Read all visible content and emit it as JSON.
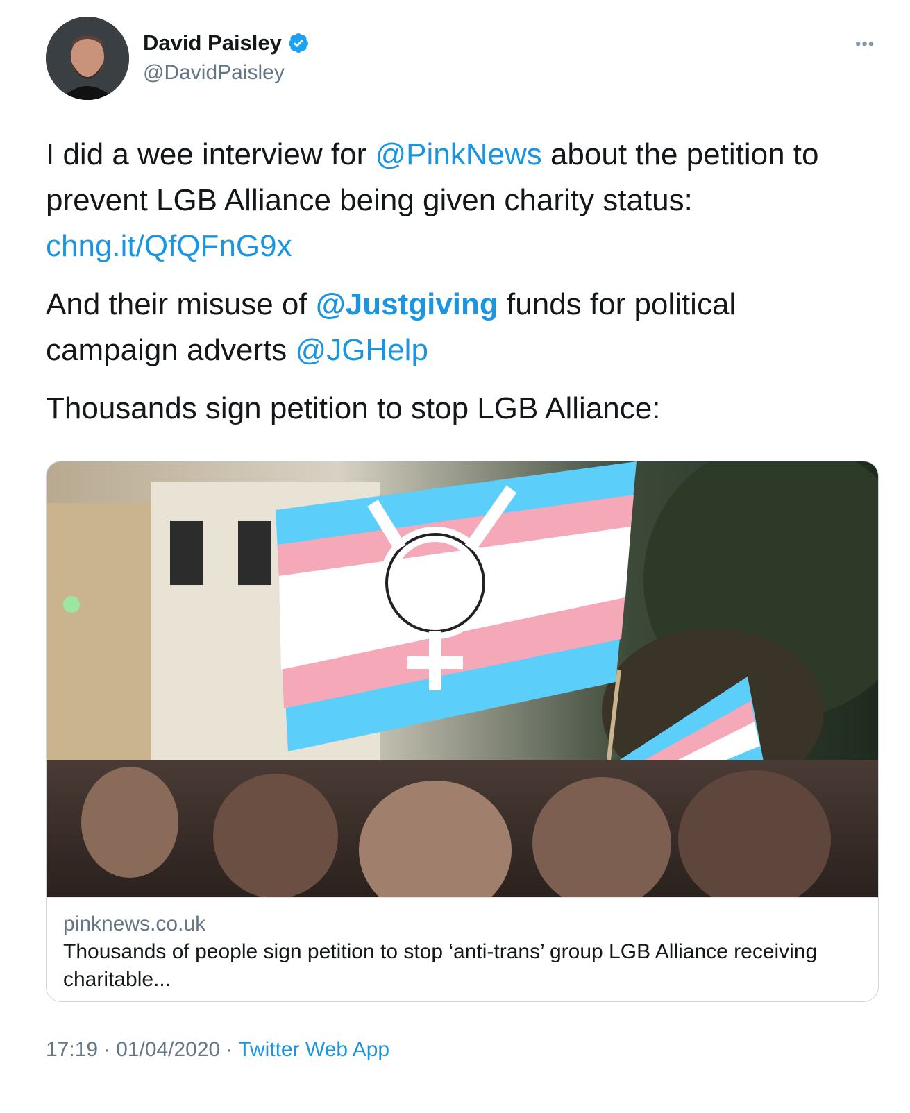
{
  "author": {
    "name": "David Paisley",
    "handle": "@DavidPaisley",
    "verified": true,
    "avatar": "avatar-photo"
  },
  "more_icon": "ellipsis-icon",
  "tweet": {
    "p1": {
      "t1": "I did a wee interview for ",
      "mention": "@PinkNews",
      "t2": " about the petition to prevent LGB Alliance being given charity status: ",
      "link": "chng.it/QfQFnG9x"
    },
    "p2": {
      "t1": "And their misuse of ",
      "mention": "@Justgiving",
      "t2": " funds for political campaign adverts ",
      "mention2": "@JGHelp"
    },
    "p3": "Thousands sign petition to stop LGB Alliance:"
  },
  "card": {
    "image": "transgender-pride-flag-rally-photo",
    "domain": "pinknews.co.uk",
    "title": "Thousands of people sign petition to stop ‘anti-trans’ group LGB Alliance receiving charitable..."
  },
  "footer": {
    "time": "17:19",
    "date": "01/04/2020",
    "separator": "·",
    "source": "Twitter Web App"
  },
  "colors": {
    "link": "#1b95e0",
    "secondary": "#657786",
    "border": "#ccd6dd",
    "trans_blue": "#5bcefa",
    "trans_pink": "#f5a9b8"
  }
}
